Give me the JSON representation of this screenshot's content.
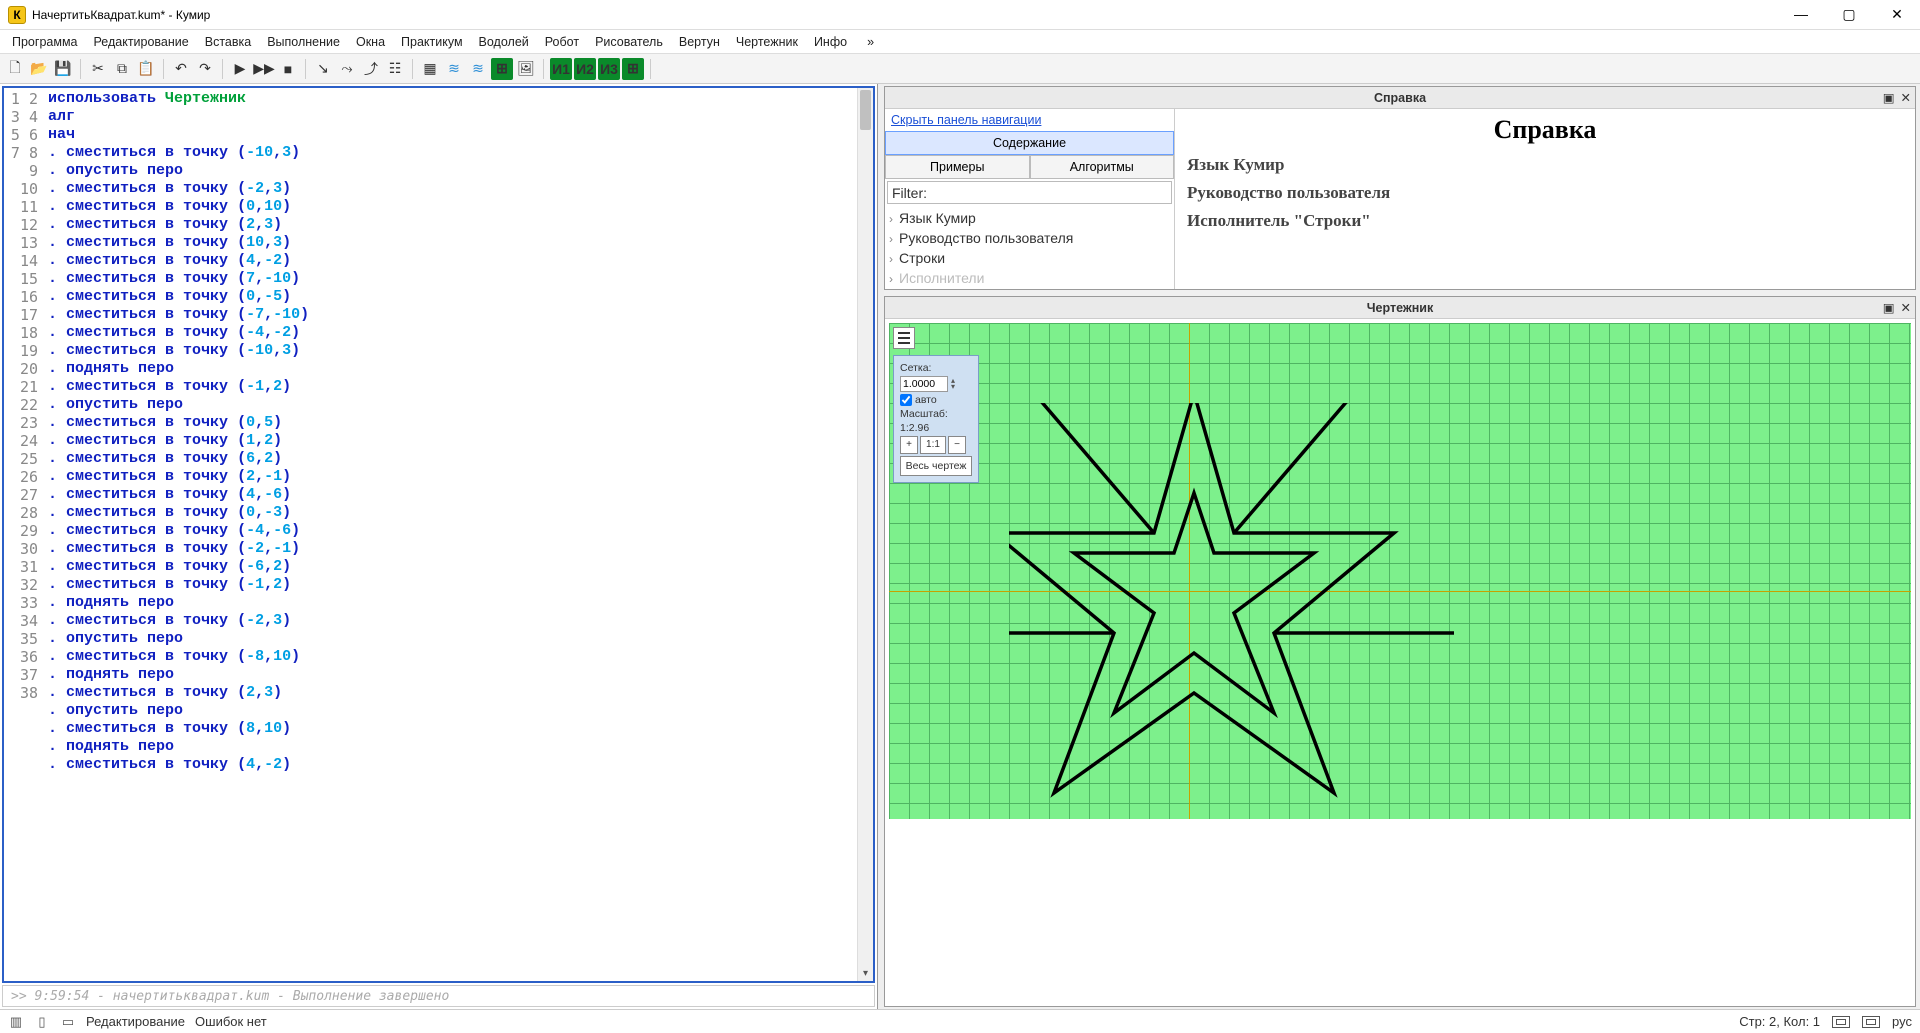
{
  "window": {
    "title": "НачертитьКвадрат.kum* - Кумир",
    "app_badge": "К"
  },
  "menu": {
    "items": [
      "Программа",
      "Редактирование",
      "Вставка",
      "Выполнение",
      "Окна",
      "Практикум",
      "Водолей",
      "Робот",
      "Рисователь",
      "Вертун",
      "Чертежник",
      "Инфо"
    ],
    "overflow": "»"
  },
  "editor": {
    "lines": [
      {
        "n": 1,
        "tokens": [
          {
            "t": "использовать ",
            "c": "kw-blue"
          },
          {
            "t": "Чертежник",
            "c": "kw-green"
          }
        ]
      },
      {
        "n": 2,
        "tokens": [
          {
            "t": "алг",
            "c": "kw-blue"
          }
        ]
      },
      {
        "n": 3,
        "tokens": [
          {
            "t": "нач",
            "c": "kw-blue"
          }
        ]
      },
      {
        "n": 4,
        "cmd": "сместиться в точку",
        "args": [
          "-10",
          "3"
        ]
      },
      {
        "n": 5,
        "cmd": "опустить перо"
      },
      {
        "n": 6,
        "cmd": "сместиться в точку",
        "args": [
          "-2",
          "3"
        ]
      },
      {
        "n": 7,
        "cmd": "сместиться в точку",
        "args": [
          "0",
          "10"
        ]
      },
      {
        "n": 8,
        "cmd": "сместиться в точку",
        "args": [
          "2",
          "3"
        ]
      },
      {
        "n": 9,
        "cmd": "сместиться в точку",
        "args": [
          "10",
          "3"
        ]
      },
      {
        "n": 10,
        "cmd": "сместиться в точку",
        "args": [
          "4",
          "-2"
        ]
      },
      {
        "n": 11,
        "cmd": "сместиться в точку",
        "args": [
          "7",
          "-10"
        ]
      },
      {
        "n": 12,
        "cmd": "сместиться в точку",
        "args": [
          "0",
          "-5"
        ]
      },
      {
        "n": 13,
        "cmd": "сместиться в точку",
        "args": [
          "-7",
          "-10"
        ]
      },
      {
        "n": 14,
        "cmd": "сместиться в точку",
        "args": [
          "-4",
          "-2"
        ]
      },
      {
        "n": 15,
        "cmd": "сместиться в точку",
        "args": [
          "-10",
          "3"
        ]
      },
      {
        "n": 16,
        "cmd": "поднять перо"
      },
      {
        "n": 17,
        "cmd": "сместиться в точку",
        "args": [
          "-1",
          "2"
        ]
      },
      {
        "n": 18,
        "cmd": "опустить перо"
      },
      {
        "n": 19,
        "cmd": "сместиться в точку",
        "args": [
          "0",
          "5"
        ]
      },
      {
        "n": 20,
        "cmd": "сместиться в точку",
        "args": [
          "1",
          "2"
        ]
      },
      {
        "n": 21,
        "cmd": "сместиться в точку",
        "args": [
          "6",
          "2"
        ]
      },
      {
        "n": 22,
        "cmd": "сместиться в точку",
        "args": [
          "2",
          "-1"
        ]
      },
      {
        "n": 23,
        "cmd": "сместиться в точку",
        "args": [
          "4",
          "-6"
        ]
      },
      {
        "n": 24,
        "cmd": "сместиться в точку",
        "args": [
          "0",
          "-3"
        ]
      },
      {
        "n": 25,
        "cmd": "сместиться в точку",
        "args": [
          "-4",
          "-6"
        ]
      },
      {
        "n": 26,
        "cmd": "сместиться в точку",
        "args": [
          "-2",
          "-1"
        ]
      },
      {
        "n": 27,
        "cmd": "сместиться в точку",
        "args": [
          "-6",
          "2"
        ]
      },
      {
        "n": 28,
        "cmd": "сместиться в точку",
        "args": [
          "-1",
          "2"
        ]
      },
      {
        "n": 29,
        "cmd": "поднять перо"
      },
      {
        "n": 30,
        "cmd": "сместиться в точку",
        "args": [
          "-2",
          "3"
        ]
      },
      {
        "n": 31,
        "cmd": "опустить перо"
      },
      {
        "n": 32,
        "cmd": "сместиться в точку",
        "args": [
          "-8",
          "10"
        ]
      },
      {
        "n": 33,
        "cmd": "поднять перо"
      },
      {
        "n": 34,
        "cmd": "сместиться в точку",
        "args": [
          "2",
          "3"
        ]
      },
      {
        "n": 35,
        "cmd": "опустить перо"
      },
      {
        "n": 36,
        "cmd": "сместиться в точку",
        "args": [
          "8",
          "10"
        ]
      },
      {
        "n": 37,
        "cmd": "поднять перо"
      },
      {
        "n": 38,
        "cmd": "сместиться в точку",
        "args": [
          "4",
          "-2"
        ]
      }
    ]
  },
  "console": {
    "text": ">>  9:59:54 - начертитьквадрат.kum - Выполнение завершено"
  },
  "help": {
    "panel_title": "Справка",
    "hide_nav": "Скрыть панель навигации",
    "tabs": {
      "content": "Содержание",
      "examples": "Примеры",
      "algorithms": "Алгоритмы"
    },
    "filter_label": "Filter:",
    "tree": [
      "Язык Кумир",
      "Руководство пользователя",
      "Строки",
      "Исполнители"
    ],
    "right_title": "Справка",
    "right_links": [
      "Язык Кумир",
      "Руководство пользователя",
      "Исполнитель \"Строки\""
    ]
  },
  "drawer": {
    "panel_title": "Чертежник",
    "grid_label": "Сетка:",
    "grid_value": "1.0000",
    "auto_label": "авто",
    "scale_label": "Масштаб:",
    "scale_value": "1:2.96",
    "zoom_in": "+",
    "zoom_11": "1:1",
    "zoom_out": "−",
    "fit_all": "Весь чертеж",
    "star_outer": [
      [
        -10,
        3
      ],
      [
        -2,
        3
      ],
      [
        0,
        10
      ],
      [
        2,
        3
      ],
      [
        10,
        3
      ],
      [
        4,
        -2
      ],
      [
        7,
        -10
      ],
      [
        0,
        -5
      ],
      [
        -7,
        -10
      ],
      [
        -4,
        -2
      ]
    ],
    "star_inner": [
      [
        -1,
        2
      ],
      [
        0,
        5
      ],
      [
        1,
        2
      ],
      [
        6,
        2
      ],
      [
        2,
        -1
      ],
      [
        4,
        -6
      ],
      [
        0,
        -3
      ],
      [
        -4,
        -6
      ],
      [
        -2,
        -1
      ],
      [
        -6,
        2
      ]
    ],
    "rays": [
      [
        [
          -2,
          3
        ],
        [
          -8,
          10
        ]
      ],
      [
        [
          2,
          3
        ],
        [
          8,
          10
        ]
      ],
      [
        [
          4,
          -2
        ],
        [
          13,
          -2
        ]
      ],
      [
        [
          -4,
          -2
        ],
        [
          -13,
          -2
        ]
      ]
    ]
  },
  "status": {
    "mode": "Редактирование",
    "errors": "Ошибок нет",
    "cursor": "Стр: 2, Кол: 1",
    "lang": "рус"
  }
}
